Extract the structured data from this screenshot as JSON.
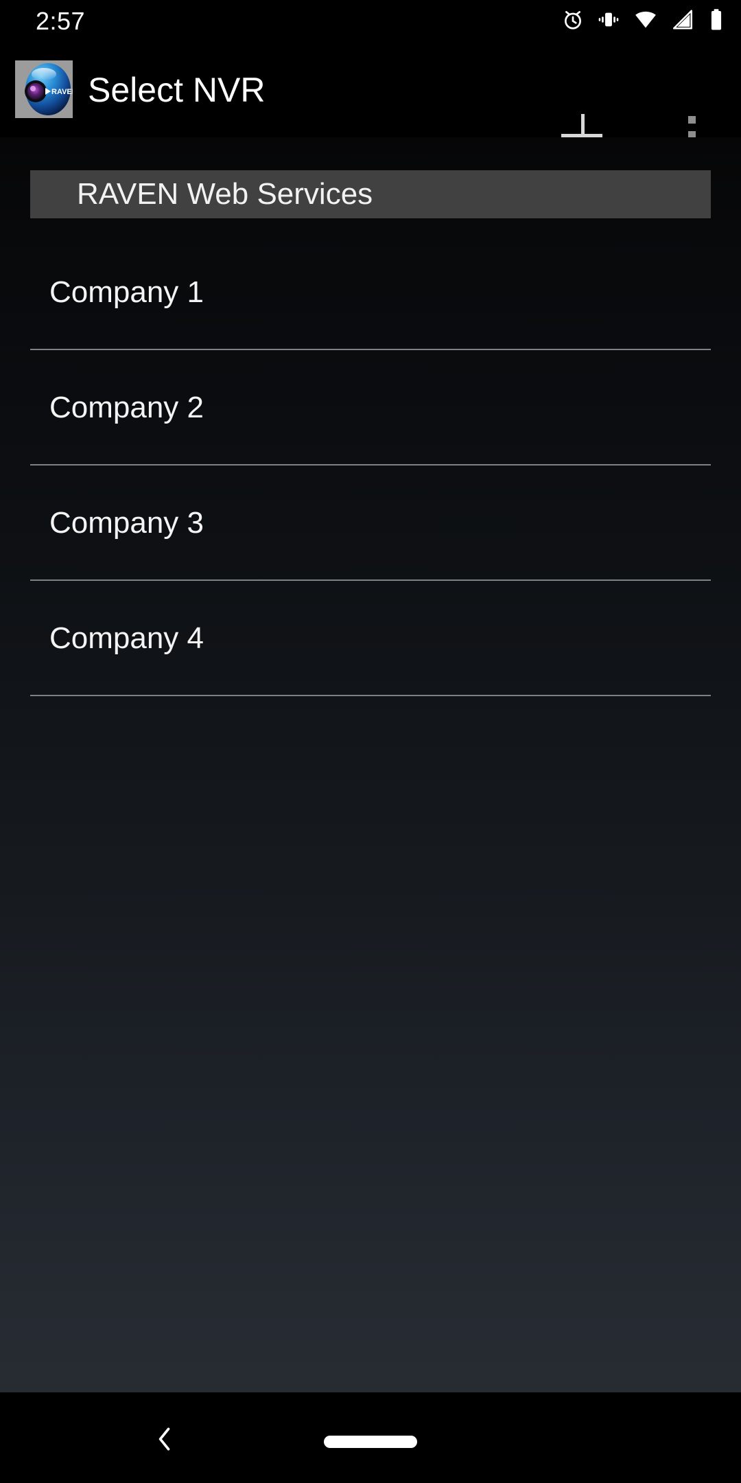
{
  "status_bar": {
    "time": "2:57",
    "icons": [
      {
        "name": "alarm-icon",
        "label": "alarm"
      },
      {
        "name": "vibrate-icon",
        "label": "vibrate"
      },
      {
        "name": "wifi-icon",
        "label": "wifi"
      },
      {
        "name": "cellular-signal-icon",
        "label": "cellular signal"
      },
      {
        "name": "battery-icon",
        "label": "battery"
      }
    ]
  },
  "app_bar": {
    "logo_alt": "RAVEN IP",
    "logo_text": "RAVEN IP",
    "title": "Select NVR",
    "add_label": "+",
    "overflow_label": "More options"
  },
  "content": {
    "section_header": "RAVEN Web Services",
    "items": [
      {
        "label": "Company 1"
      },
      {
        "label": "Company 2"
      },
      {
        "label": "Company 3"
      },
      {
        "label": "Company 4"
      }
    ]
  },
  "nav_bar": {
    "back_label": "Back",
    "home_label": "Home"
  },
  "colors": {
    "background": "#000000",
    "section_header_bg": "#414141",
    "divider": "#7e8186",
    "text_primary": "#f4f4f4",
    "accent_logo_blue": "#1d7fd0",
    "gradient_bottom": "#272c33"
  }
}
